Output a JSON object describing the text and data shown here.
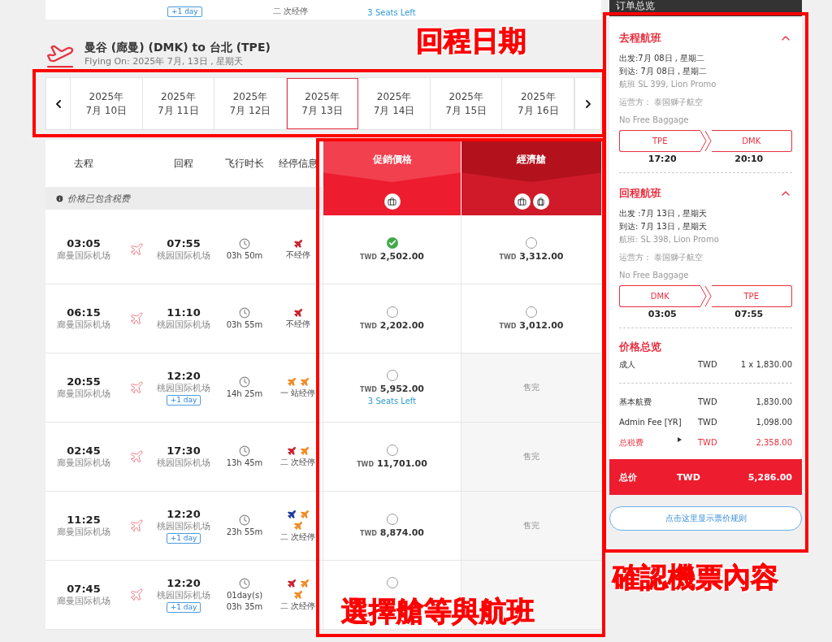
{
  "top_strip": {
    "badge": "+1 day",
    "stops": "二 次经停",
    "seats": "3 Seats Left"
  },
  "route": {
    "title": "曼谷 (廊曼) (DMK)  to  台北 (TPE)",
    "subtitle": "Flying On: 2025年 7月, 13日 , 星期天"
  },
  "date_strip": {
    "dates": [
      {
        "year": "2025年",
        "day": "7月 10日",
        "selected": false
      },
      {
        "year": "2025年",
        "day": "7月 11日",
        "selected": false
      },
      {
        "year": "2025年",
        "day": "7月 12日",
        "selected": false
      },
      {
        "year": "2025年",
        "day": "7月 13日",
        "selected": true
      },
      {
        "year": "2025年",
        "day": "7月 14日",
        "selected": false
      },
      {
        "year": "2025年",
        "day": "7月 15日",
        "selected": false
      },
      {
        "year": "2025年",
        "day": "7月 16日",
        "selected": false
      }
    ]
  },
  "table": {
    "columns": [
      "去程",
      "回程",
      "飞行时长",
      "经停信息"
    ],
    "note": "价格已包含税费",
    "fares": [
      {
        "title": "促銷價格",
        "kind": "promo",
        "baggage": [
          {
            "kind": "cabin"
          }
        ]
      },
      {
        "title": "經濟艙",
        "kind": "economy",
        "baggage": [
          {
            "kind": "cabin"
          },
          {
            "kind": "checked"
          }
        ]
      }
    ],
    "rows": [
      {
        "depart": "03:05",
        "depart_airport": "廊曼国际机场",
        "arrive": "07:55",
        "arrive_airport": "桃园国际机场",
        "duration": [
          "03h 50m"
        ],
        "carriers": [
          {
            "color": "#c8202f"
          }
        ],
        "stops": "不经停",
        "fares": [
          {
            "kind": "price",
            "selected": true,
            "currency": "TWD",
            "amount": "2,502.00"
          },
          {
            "kind": "price",
            "selected": false,
            "currency": "TWD",
            "amount": "3,312.00"
          }
        ]
      },
      {
        "depart": "06:15",
        "depart_airport": "廊曼国际机场",
        "arrive": "11:10",
        "arrive_airport": "桃园国际机场",
        "duration": [
          "03h 55m"
        ],
        "carriers": [
          {
            "color": "#c8202f"
          }
        ],
        "stops": "不经停",
        "fares": [
          {
            "kind": "price",
            "selected": false,
            "currency": "TWD",
            "amount": "2,202.00"
          },
          {
            "kind": "price",
            "selected": false,
            "currency": "TWD",
            "amount": "3,012.00"
          }
        ]
      },
      {
        "depart": "20:55",
        "depart_airport": "廊曼国际机场",
        "arrive": "12:20",
        "arrive_airport": "桃园国际机场",
        "next_day": "+1 day",
        "duration": [
          "14h 25m"
        ],
        "carriers": [
          {
            "color": "#f08a24"
          },
          {
            "color": "#f08a24"
          }
        ],
        "stops": "一 站经停",
        "fares": [
          {
            "kind": "price",
            "selected": false,
            "currency": "TWD",
            "amount": "5,952.00",
            "seats": "3 Seats Left"
          },
          {
            "kind": "sold_out",
            "text": "售完"
          }
        ]
      },
      {
        "depart": "02:45",
        "depart_airport": "廊曼国际机场",
        "arrive": "17:30",
        "arrive_airport": "桃园国际机场",
        "duration": [
          "13h 45m"
        ],
        "carriers": [
          {
            "color": "#c8202f"
          },
          {
            "color": "#f08a24"
          }
        ],
        "stops": "二 次经停",
        "fares": [
          {
            "kind": "price",
            "selected": false,
            "currency": "TWD",
            "amount": "11,701.00"
          },
          {
            "kind": "sold_out",
            "text": "售完"
          }
        ]
      },
      {
        "depart": "11:25",
        "depart_airport": "廊曼国际机场",
        "arrive": "12:20",
        "arrive_airport": "桃园国际机场",
        "next_day": "+1 day",
        "duration": [
          "23h 55m"
        ],
        "carriers": [
          {
            "color": "#1f3a9a"
          },
          {
            "color": "#f08a24"
          },
          {
            "color": "#f08a24"
          }
        ],
        "stops": "二 次经停",
        "fares": [
          {
            "kind": "price",
            "selected": false,
            "currency": "TWD",
            "amount": "8,874.00"
          },
          {
            "kind": "sold_out",
            "text": "售完"
          }
        ]
      },
      {
        "depart": "07:45",
        "depart_airport": "廊曼国际机场",
        "arrive": "12:20",
        "arrive_airport": "桃园国际机场",
        "next_day": "+1 day",
        "duration": [
          "01day(s)",
          "03h 35m"
        ],
        "carriers": [
          {
            "color": "#c8202f"
          },
          {
            "color": "#f08a24"
          },
          {
            "color": "#f08a24"
          }
        ],
        "stops": "二 次经停",
        "fares": [
          {
            "kind": "radio_only",
            "selected": false
          },
          {
            "kind": "covered"
          }
        ]
      }
    ]
  },
  "summary": {
    "title": "订单总览",
    "segments": [
      {
        "title": "去程航班",
        "expanded": true,
        "depart": "出发:7月 08日 , 星期二",
        "arrive": "到达: 7月 08日 , 星期二",
        "flight": "航班 SL 399, Lion Promo",
        "operator": "运营方： 泰国獅子航空",
        "baggage": "No Free Baggage",
        "from": "TPE",
        "to": "DMK",
        "from_time": "17:20",
        "to_time": "20:10"
      },
      {
        "title": "回程航班",
        "expanded": true,
        "depart": "出发 :7月 13日 , 星期天",
        "arrive": "到达: 7月 13日 , 星期天",
        "flight": "航班: SL 398, Lion Promo",
        "operator": "运营方： 泰国獅子航空",
        "baggage": "No Free Baggage",
        "from": "DMK",
        "to": "TPE",
        "from_time": "03:05",
        "to_time": "07:55"
      }
    ],
    "price_title": "价格总览",
    "passengers": [
      {
        "label": "成人",
        "currency": "TWD",
        "amount": "1 x 1,830.00"
      }
    ],
    "lines": [
      {
        "kind": "plain",
        "label": "基本航费",
        "currency": "TWD",
        "amount": "1,830.00"
      },
      {
        "kind": "plain",
        "label": "Admin Fee [YR]",
        "currency": "TWD",
        "amount": "1,098.00"
      },
      {
        "kind": "tax",
        "label": "总税费",
        "currency": "TWD",
        "amount": "2,358.00"
      }
    ],
    "total": {
      "label": "总价",
      "currency": "TWD",
      "amount": "5,286.00"
    },
    "rules_button": "点击这里显示票价规则"
  },
  "annotations": [
    {
      "kind": "dates",
      "text": "回程日期"
    },
    {
      "kind": "fares",
      "text": "選擇艙等與航班"
    },
    {
      "kind": "summary",
      "text": "確認機票內容"
    }
  ]
}
